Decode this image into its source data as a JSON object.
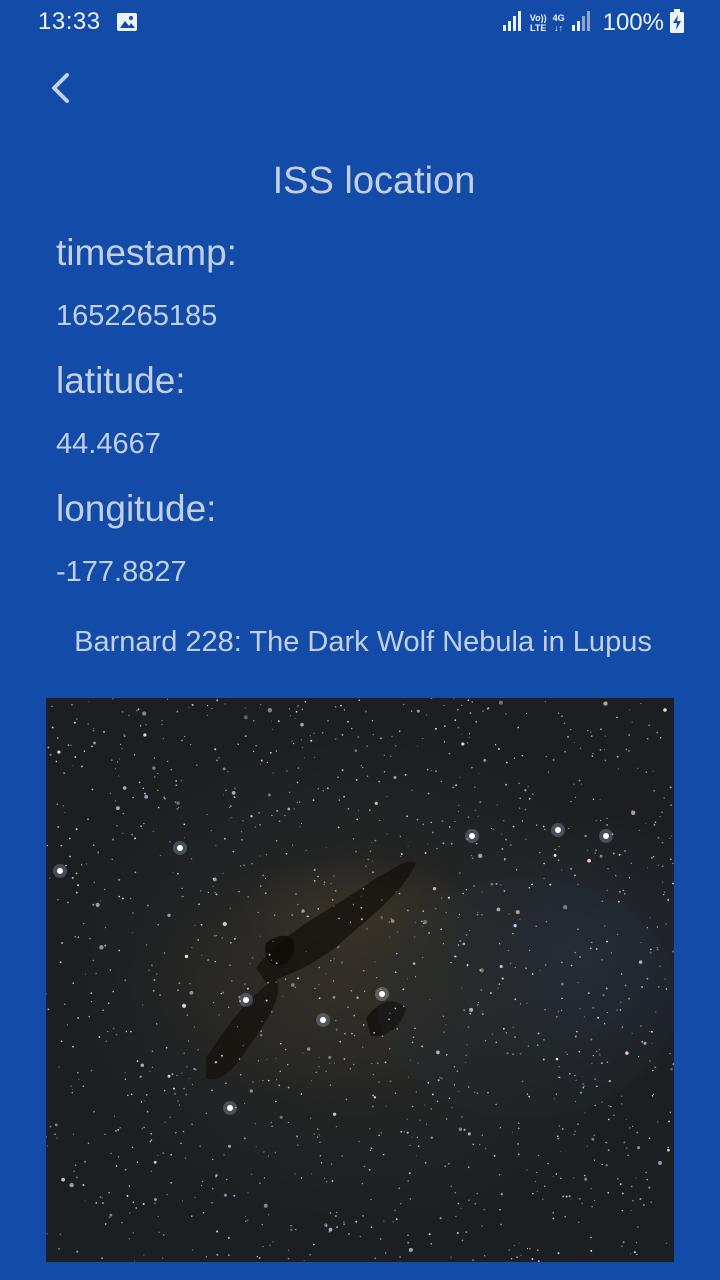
{
  "status_bar": {
    "time": "13:33",
    "battery": "100%",
    "network_volte": "Vo)) LTE",
    "network_4g": "4G",
    "icons": [
      "gallery-icon",
      "signal-icon",
      "volte-icon",
      "4g-icon",
      "signal-icon",
      "battery-charging-icon"
    ]
  },
  "header": {
    "back_icon": "chevron-left-icon"
  },
  "page": {
    "title": "ISS location"
  },
  "iss": {
    "timestamp_label": "timestamp:",
    "timestamp_value": "1652265185",
    "latitude_label": "latitude:",
    "latitude_value": "44.4667",
    "longitude_label": "longitude:",
    "longitude_value": "-177.8827"
  },
  "apod": {
    "title": "Barnard 228: The Dark Wolf Nebula in Lupus"
  },
  "colors": {
    "background": "#124ba8",
    "text": "#c3cfe6"
  }
}
